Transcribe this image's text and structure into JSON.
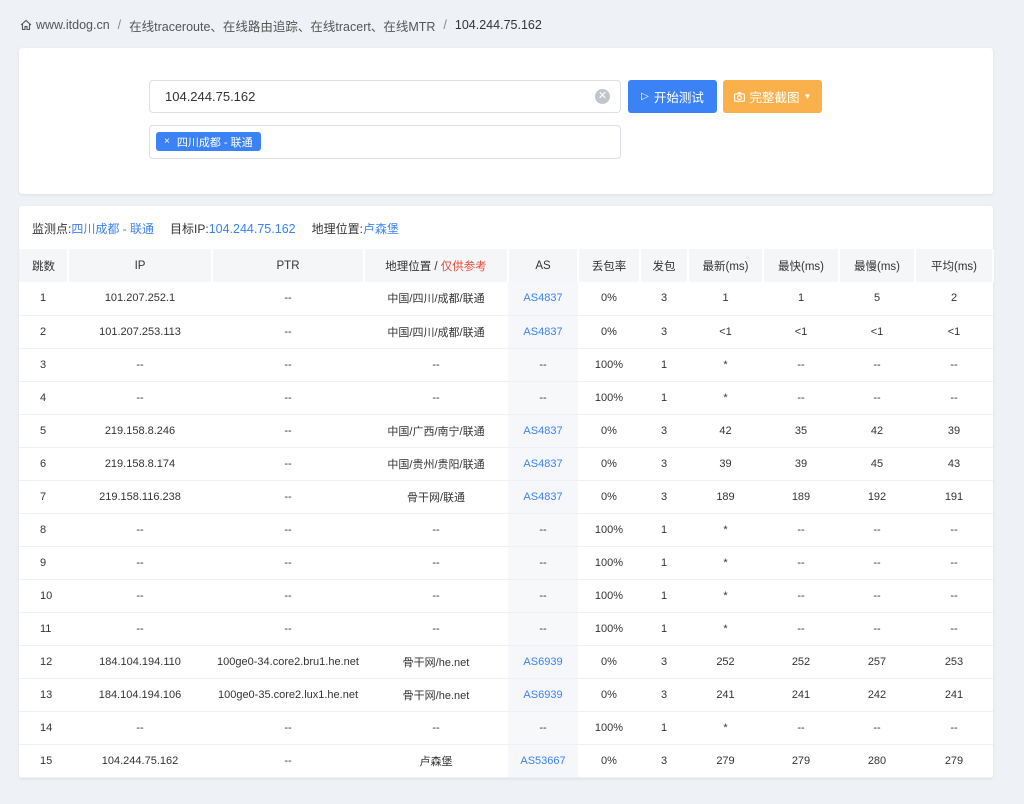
{
  "breadcrumb": {
    "home": "www.itdog.cn",
    "page": "在线traceroute、在线路由追踪、在线tracert、在线MTR",
    "current": "104.244.75.162"
  },
  "form": {
    "ip_value": "104.244.75.162",
    "start_label": "开始测试",
    "screenshot_label": "完整截图",
    "node_tag": "四川成都 - 联通"
  },
  "summary": {
    "monitor_label": "监测点:",
    "monitor_value": "四川成都 - 联通",
    "target_label": "目标IP:",
    "target_value": "104.244.75.162",
    "geo_label": "地理位置:",
    "geo_value": "卢森堡"
  },
  "columns": {
    "hop": "跳数",
    "ip": "IP",
    "ptr": "PTR",
    "geo": "地理位置 / ",
    "geo_note": "仅供参考",
    "as": "AS",
    "loss": "丢包率",
    "sent": "发包",
    "last": "最新(ms)",
    "best": "最快(ms)",
    "worst": "最慢(ms)",
    "avg": "平均(ms)"
  },
  "rows": [
    [
      "1",
      "101.207.252.1",
      "--",
      "中国/四川/成都/联通",
      "AS4837",
      "0%",
      "3",
      "1",
      "1",
      "5",
      "2"
    ],
    [
      "2",
      "101.207.253.113",
      "--",
      "中国/四川/成都/联通",
      "AS4837",
      "0%",
      "3",
      "<1",
      "<1",
      "<1",
      "<1"
    ],
    [
      "3",
      "--",
      "--",
      "--",
      "--",
      "100%",
      "1",
      "*",
      "--",
      "--",
      "--"
    ],
    [
      "4",
      "--",
      "--",
      "--",
      "--",
      "100%",
      "1",
      "*",
      "--",
      "--",
      "--"
    ],
    [
      "5",
      "219.158.8.246",
      "--",
      "中国/广西/南宁/联通",
      "AS4837",
      "0%",
      "3",
      "42",
      "35",
      "42",
      "39"
    ],
    [
      "6",
      "219.158.8.174",
      "--",
      "中国/贵州/贵阳/联通",
      "AS4837",
      "0%",
      "3",
      "39",
      "39",
      "45",
      "43"
    ],
    [
      "7",
      "219.158.116.238",
      "--",
      "骨干网/联通",
      "AS4837",
      "0%",
      "3",
      "189",
      "189",
      "192",
      "191"
    ],
    [
      "8",
      "--",
      "--",
      "--",
      "--",
      "100%",
      "1",
      "*",
      "--",
      "--",
      "--"
    ],
    [
      "9",
      "--",
      "--",
      "--",
      "--",
      "100%",
      "1",
      "*",
      "--",
      "--",
      "--"
    ],
    [
      "10",
      "--",
      "--",
      "--",
      "--",
      "100%",
      "1",
      "*",
      "--",
      "--",
      "--"
    ],
    [
      "11",
      "--",
      "--",
      "--",
      "--",
      "100%",
      "1",
      "*",
      "--",
      "--",
      "--"
    ],
    [
      "12",
      "184.104.194.110",
      "100ge0-34.core2.bru1.he.net",
      "骨干网/he.net",
      "AS6939",
      "0%",
      "3",
      "252",
      "252",
      "257",
      "253"
    ],
    [
      "13",
      "184.104.194.106",
      "100ge0-35.core2.lux1.he.net",
      "骨干网/he.net",
      "AS6939",
      "0%",
      "3",
      "241",
      "241",
      "242",
      "241"
    ],
    [
      "14",
      "--",
      "--",
      "--",
      "--",
      "100%",
      "1",
      "*",
      "--",
      "--",
      "--"
    ],
    [
      "15",
      "104.244.75.162",
      "--",
      "卢森堡",
      "AS53667",
      "0%",
      "3",
      "279",
      "279",
      "280",
      "279"
    ]
  ]
}
